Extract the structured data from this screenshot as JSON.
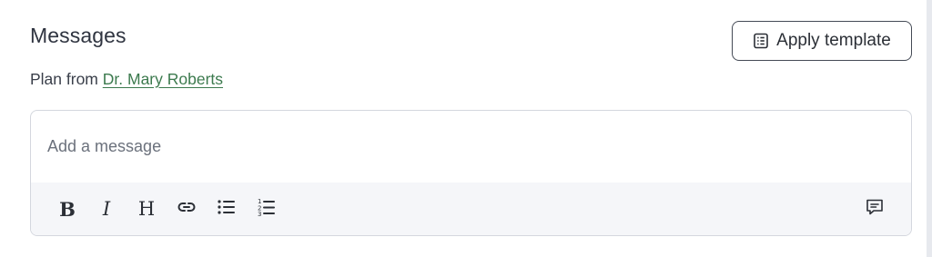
{
  "header": {
    "title": "Messages",
    "apply_template_label": "Apply template",
    "apply_template_icon": "template-list-icon"
  },
  "plan": {
    "prefix": "Plan from",
    "author": "Dr. Mary Roberts",
    "link_color": "#3c7a4e"
  },
  "editor": {
    "placeholder": "Add a message",
    "value": "",
    "toolbar": {
      "bold": "B",
      "italic": "I",
      "heading": "H",
      "icons": [
        "link-icon",
        "bullet-list-icon",
        "numbered-list-icon",
        "comment-icon"
      ]
    }
  }
}
